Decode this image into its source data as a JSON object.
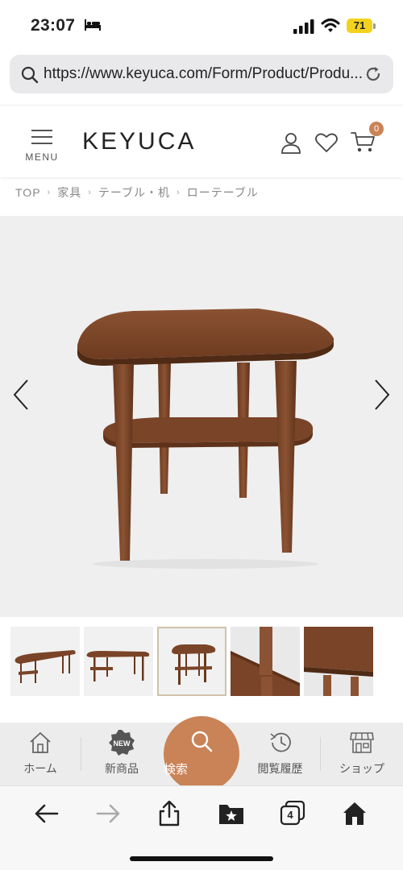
{
  "status_bar": {
    "time": "23:07",
    "battery": "71"
  },
  "browser": {
    "url": "https://www.keyuca.com/Form/Product/Produ...",
    "icons": [
      "search-icon",
      "reload-icon"
    ]
  },
  "header": {
    "menu_label": "MENU",
    "logo": "KEYUCA",
    "cart_count": "0",
    "icons": [
      "user-icon",
      "heart-icon",
      "cart-icon"
    ]
  },
  "breadcrumb": {
    "items": [
      "TOP",
      "家具",
      "テーブル・机",
      "ローテーブル"
    ],
    "separator": "›"
  },
  "gallery": {
    "thumbnail_count": 5,
    "active_thumbnail": 3
  },
  "site_nav": {
    "items": [
      {
        "label": "ホーム",
        "icon": "house-icon"
      },
      {
        "label": "新商品",
        "icon": "new-badge-icon",
        "badge": "NEW"
      },
      {
        "label": "検索",
        "icon": "search-icon"
      },
      {
        "label": "閲覧履歴",
        "icon": "history-icon"
      },
      {
        "label": "ショップ",
        "icon": "shop-icon"
      }
    ]
  },
  "toolbar": {
    "tabs_count": "4",
    "icons": [
      "back-arrow-icon",
      "forward-arrow-icon",
      "share-icon",
      "bookmarks-icon",
      "tabs-icon",
      "home-icon"
    ]
  },
  "colors": {
    "accent": "#c98356",
    "wood": "#7a4428",
    "battery": "#f2d21e"
  }
}
